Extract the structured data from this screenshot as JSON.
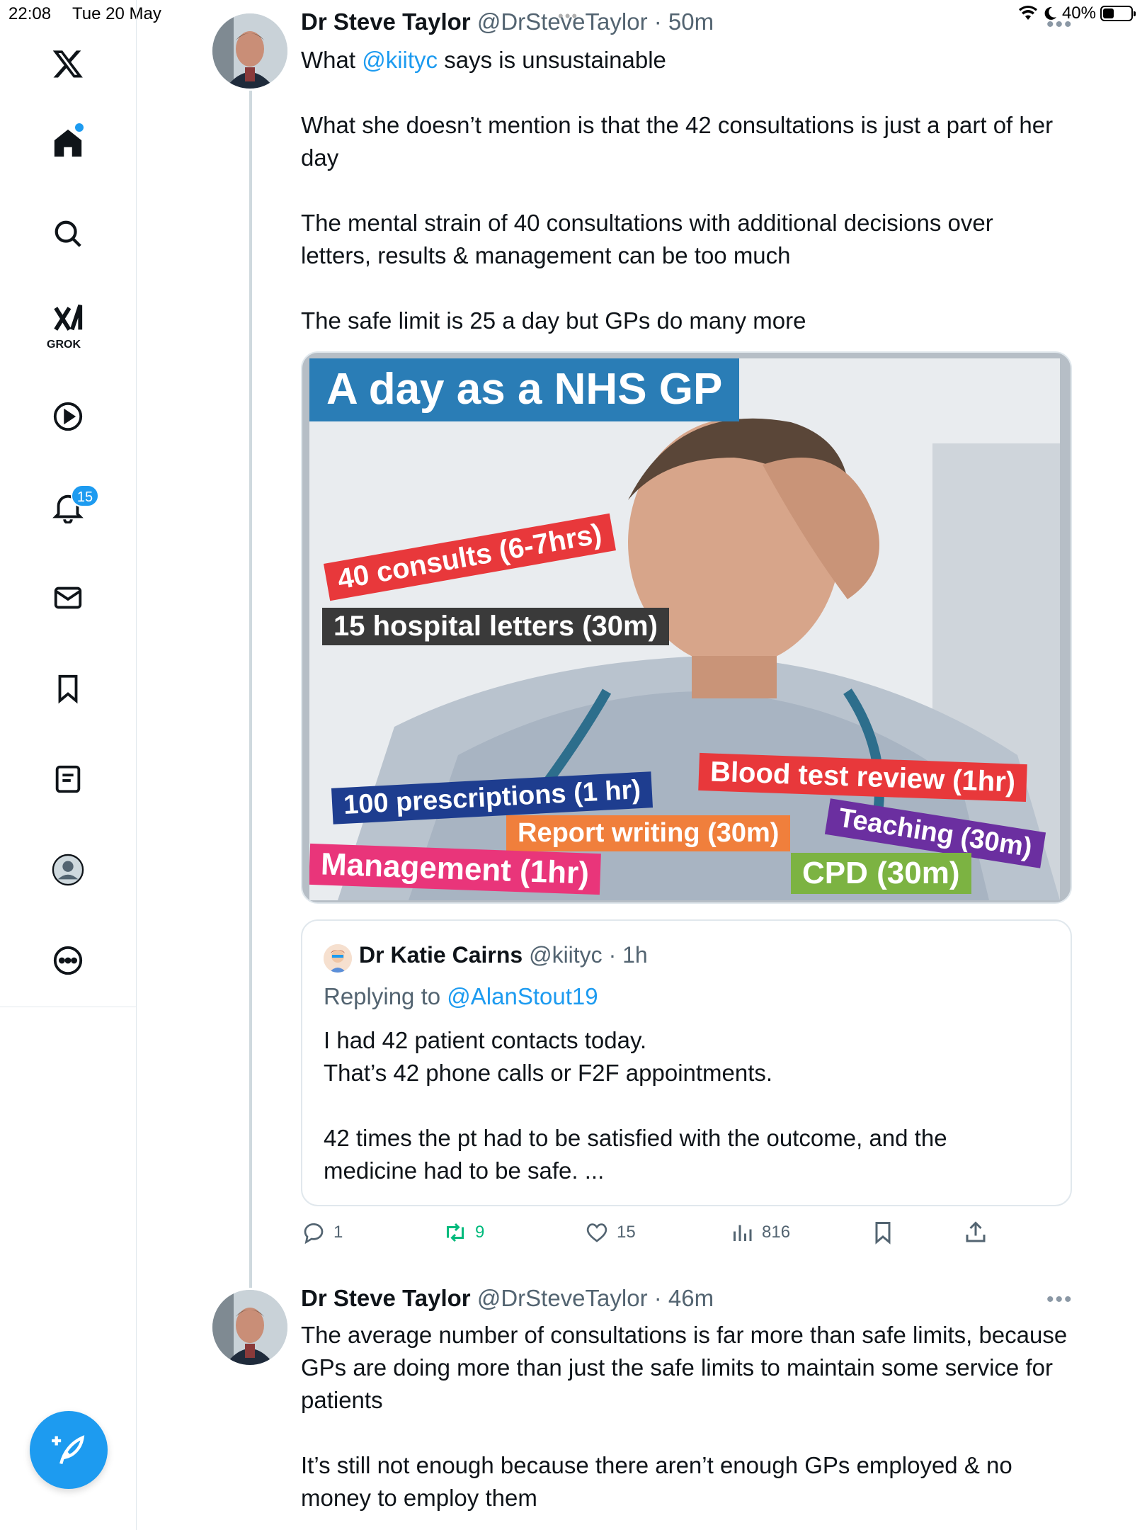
{
  "status_bar": {
    "time": "22:08",
    "date": "Tue 20 May",
    "battery": "40%",
    "battery_level": 0.4
  },
  "sidebar": {
    "items": [
      {
        "name": "X"
      },
      {
        "name": "Home"
      },
      {
        "name": "Search"
      },
      {
        "name": "Grok",
        "label": "GROK"
      },
      {
        "name": "Videos"
      },
      {
        "name": "Notifications",
        "badge": "15"
      },
      {
        "name": "Messages"
      },
      {
        "name": "Bookmarks"
      },
      {
        "name": "Lists"
      },
      {
        "name": "Profile"
      },
      {
        "name": "More"
      }
    ]
  },
  "tweet1": {
    "name": "Dr Steve Taylor",
    "handle": "@DrSteveTaylor",
    "time": "· 50m",
    "text_pre": "What ",
    "mention": "@kiityc",
    "text_post": " says is unsustainable",
    "paragraphs": [
      "What she doesn’t mention is that the 42 consultations is just a part of her day",
      "The mental strain of 40 consultations with additional decisions over letters, results & management can be too much",
      "The safe limit is 25 a day but GPs do many more"
    ],
    "image": {
      "title": "A day as a NHS GP",
      "tags": [
        "40 consults (6-7hrs)",
        "15 hospital letters (30m)",
        "Blood test review (1hr)",
        "100 prescriptions  (1 hr)",
        "Teaching (30m)",
        "Report writing (30m)",
        "Management (1hr)",
        "CPD (30m)"
      ]
    },
    "quote": {
      "name": "Dr Katie Cairns",
      "handle": "@kiityc",
      "time": "· 1h",
      "replying_prefix": "Replying to ",
      "replying_to": "@AlanStout19",
      "text": "I had 42 patient contacts today.\nThat’s 42 phone calls or F2F appointments.\n\n42 times the pt had to be satisfied with the outcome, and the medicine had to be safe. ..."
    },
    "actions": {
      "replies": "1",
      "reposts": "9",
      "likes": "15",
      "views": "816"
    }
  },
  "tweet2": {
    "name": "Dr Steve Taylor",
    "handle": "@DrSteveTaylor",
    "time": "· 46m",
    "paragraphs": [
      "The average number of consultations is far more than safe limits, because GPs are doing more than just the safe limits to maintain some service for patients",
      "It’s still not enough because there aren’t enough GPs employed & no money to employ them"
    ]
  },
  "colors": {
    "accent": "#1d9bf0",
    "repost": "#00ba7c",
    "muted": "#536471"
  }
}
